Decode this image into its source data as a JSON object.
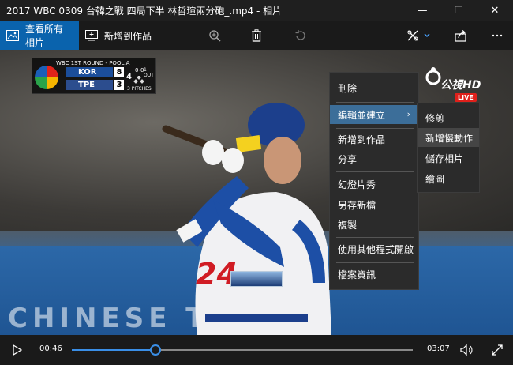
{
  "window": {
    "title": "2017 WBC 0309 台韓之戰  四局下半 林哲瑄兩分砲_.mp4 - 相片",
    "minimize_glyph": "—",
    "maximize_glyph": "☐",
    "close_glyph": "✕"
  },
  "toolbar": {
    "view_all_label": "查看所有相片",
    "add_to_label": "新增到作品",
    "right_icons": [
      "zoom-in-icon",
      "delete-icon",
      "rotate-icon",
      "edit-create-icon",
      "share-icon",
      "more-icon"
    ],
    "accent_color": "#0a63ad"
  },
  "video": {
    "scoreboard": {
      "header": "WBC 1ST ROUND - POOL A",
      "team1": "KOR",
      "team1_runs": "8",
      "team2": "TPE",
      "team2_runs": "3",
      "inning": "4",
      "count": "0-0",
      "outs": "1 OUT",
      "pitches": "3 PITCHES"
    },
    "channel_logo": "公視HD",
    "live_badge": "LIVE",
    "jersey_number": "24",
    "wall_text": "CHINESE TAIPEI"
  },
  "context_menu": {
    "items": [
      {
        "label": "刪除"
      },
      {
        "label": "編輯並建立",
        "arrow": "›"
      },
      {
        "label": "新增到作品"
      },
      {
        "label": "分享"
      },
      {
        "label": "幻燈片秀"
      },
      {
        "label": "另存新檔"
      },
      {
        "label": "複製"
      },
      {
        "label": "使用其他程式開啟"
      },
      {
        "label": "檔案資訊"
      }
    ],
    "selected_color": "#3c6e99"
  },
  "submenu": {
    "items": [
      {
        "label": "修剪"
      },
      {
        "label": "新增慢動作"
      },
      {
        "label": "儲存相片"
      },
      {
        "label": "繪圖"
      }
    ]
  },
  "controls": {
    "current_time": "00:46",
    "total_time": "03:07",
    "progress_fraction": 0.246
  }
}
